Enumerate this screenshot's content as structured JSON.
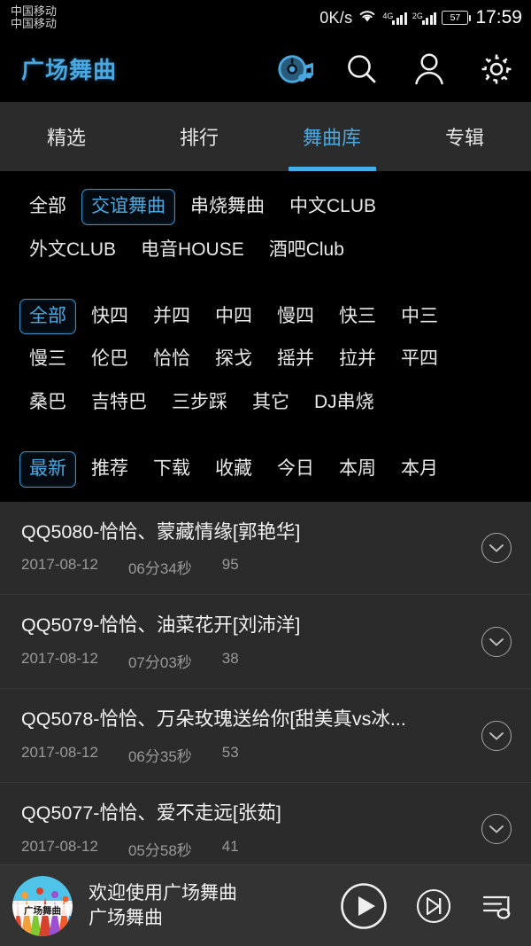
{
  "statusbar": {
    "carrier1": "中国移动",
    "carrier2": "中国移动",
    "network_speed": "0K/s",
    "sim1_gen": "4G",
    "sim2_gen": "2G",
    "battery": "57",
    "clock": "17:59",
    "wifi_icon": "wifi-icon"
  },
  "header": {
    "title": "广场舞曲",
    "icons": [
      {
        "name": "disc-music-icon"
      },
      {
        "name": "search-icon"
      },
      {
        "name": "profile-icon"
      },
      {
        "name": "settings-gear-icon"
      }
    ]
  },
  "tabs": [
    {
      "label": "精选",
      "active": false
    },
    {
      "label": "排行",
      "active": false
    },
    {
      "label": "舞曲库",
      "active": true
    },
    {
      "label": "专辑",
      "active": false
    }
  ],
  "filters": {
    "category": {
      "rows": [
        [
          "全部",
          "交谊舞曲",
          "串烧舞曲",
          "中文CLUB"
        ],
        [
          "外文CLUB",
          "电音HOUSE",
          "酒吧Club"
        ]
      ],
      "selected": "交谊舞曲"
    },
    "style": {
      "rows": [
        [
          "全部",
          "快四",
          "并四",
          "中四",
          "慢四",
          "快三",
          "中三"
        ],
        [
          "慢三",
          "伦巴",
          "恰恰",
          "探戈",
          "摇并",
          "拉并",
          "平四"
        ],
        [
          "桑巴",
          "吉特巴",
          "三步踩",
          "其它",
          "DJ串烧"
        ]
      ],
      "selected": "全部"
    },
    "sort": {
      "rows": [
        [
          "最新",
          "推荐",
          "下载",
          "收藏",
          "今日",
          "本周",
          "本月"
        ]
      ],
      "selected": "最新"
    }
  },
  "list": {
    "items": [
      {
        "title": "QQ5080-恰恰、蒙藏情缘[郭艳华]",
        "date": "2017-08-12",
        "duration": "06分34秒",
        "count": "95",
        "expand_icon": "chevron-down-circle-icon"
      },
      {
        "title": "QQ5079-恰恰、油菜花开[刘沛洋]",
        "date": "2017-08-12",
        "duration": "07分03秒",
        "count": "38",
        "expand_icon": "chevron-down-circle-icon"
      },
      {
        "title": "QQ5078-恰恰、万朵玫瑰送给你[甜美真vs冰...",
        "date": "2017-08-12",
        "duration": "06分35秒",
        "count": "53",
        "expand_icon": "chevron-down-circle-icon"
      },
      {
        "title": "QQ5077-恰恰、爱不走远[张茹]",
        "date": "2017-08-12",
        "duration": "05分58秒",
        "count": "41",
        "expand_icon": "chevron-down-circle-icon"
      }
    ]
  },
  "player": {
    "album_art_label": "广场舞曲",
    "track_title": "欢迎使用广场舞曲",
    "track_artist": "广场舞曲",
    "play_icon": "play-button-icon",
    "next_icon": "next-track-icon",
    "playlist_icon": "playlist-queue-icon"
  },
  "colors": {
    "accent": "#4aa8e0",
    "accent_bright": "#45b0e8",
    "background": "#000000",
    "panel": "#2b2b2b",
    "player_bg": "#333333",
    "text_primary": "#f2f2f2",
    "text_muted": "#9a9a9a"
  }
}
